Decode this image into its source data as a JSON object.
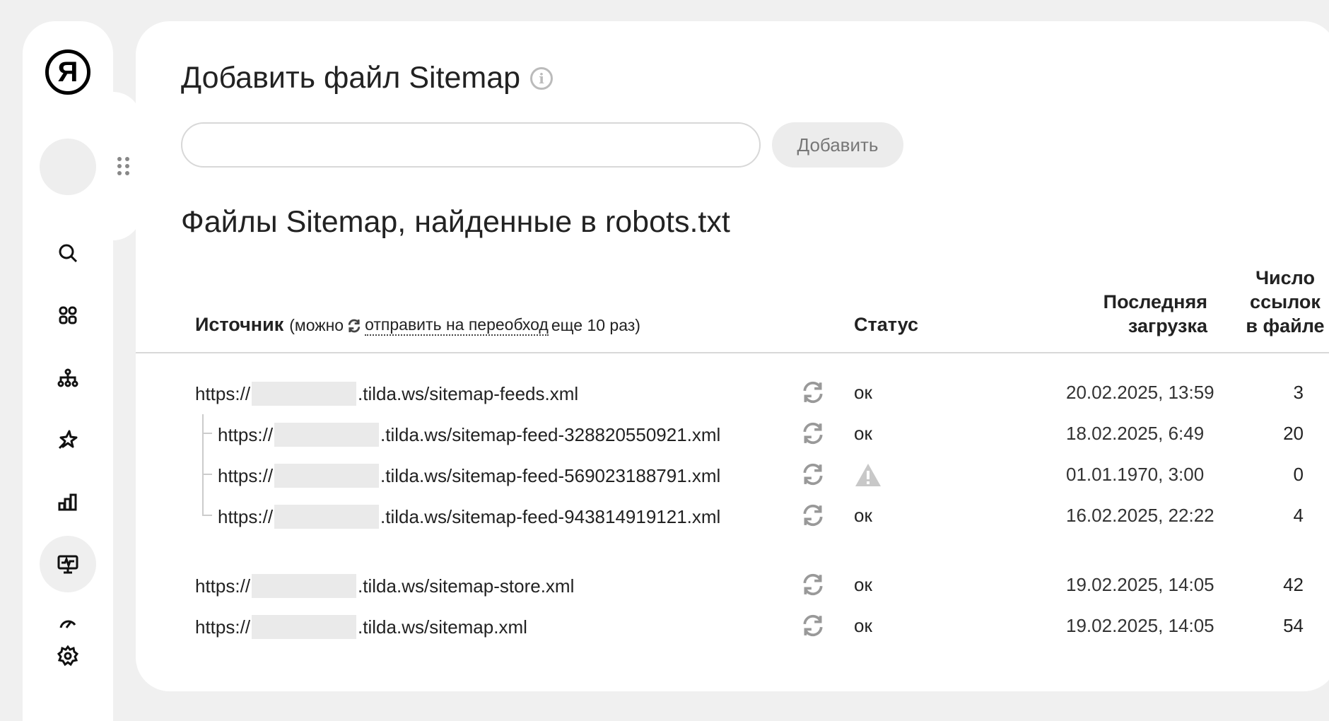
{
  "sidebar": {
    "logo": "Я",
    "icons": [
      "search-icon",
      "grid-icon",
      "sitemap-tree-icon",
      "sparkle-icon",
      "bar-chart-icon",
      "monitor-pulse-icon",
      "speedometer-icon",
      "gear-icon"
    ],
    "active_item": "monitor-pulse-icon"
  },
  "add_sitemap": {
    "title": "Добавить файл Sitemap",
    "info_icon": "i",
    "input_value": "",
    "input_placeholder": "",
    "button_label": "Добавить"
  },
  "robots_section": {
    "title": "Файлы Sitemap, найденные в robots.txt",
    "columns": {
      "source": "Источник",
      "source_note_prefix": "(можно",
      "source_note_link": "отправить на переобход",
      "source_note_suffix": "еще 10 раз)",
      "status": "Статус",
      "last_load_line1": "Последняя",
      "last_load_line2": "загрузка",
      "count_line1": "Число",
      "count_line2": "ссылок",
      "count_line3": "в файле"
    },
    "rows": [
      {
        "prefix": "https://",
        "suffix": ".tilda.ws/sitemap-feeds.xml",
        "status": "ок",
        "last_load": "20.02.2025, 13:59",
        "count": "3",
        "child": false
      },
      {
        "prefix": "https://",
        "suffix": ".tilda.ws/sitemap-feed-328820550921.xml",
        "status": "ок",
        "last_load": "18.02.2025, 6:49",
        "count": "20",
        "child": true
      },
      {
        "prefix": "https://",
        "suffix": ".tilda.ws/sitemap-feed-569023188791.xml",
        "status": "",
        "status_icon": "warning-icon",
        "last_load": "01.01.1970, 3:00",
        "count": "0",
        "child": true
      },
      {
        "prefix": "https://",
        "suffix": ".tilda.ws/sitemap-feed-943814919121.xml",
        "status": "ок",
        "last_load": "16.02.2025, 22:22",
        "count": "4",
        "child": true
      },
      {
        "prefix": "https://",
        "suffix": ".tilda.ws/sitemap-store.xml",
        "status": "ок",
        "last_load": "19.02.2025, 14:05",
        "count": "42",
        "child": false
      },
      {
        "prefix": "https://",
        "suffix": ".tilda.ws/sitemap.xml",
        "status": "ок",
        "last_load": "19.02.2025, 14:05",
        "count": "54",
        "child": false
      }
    ]
  }
}
